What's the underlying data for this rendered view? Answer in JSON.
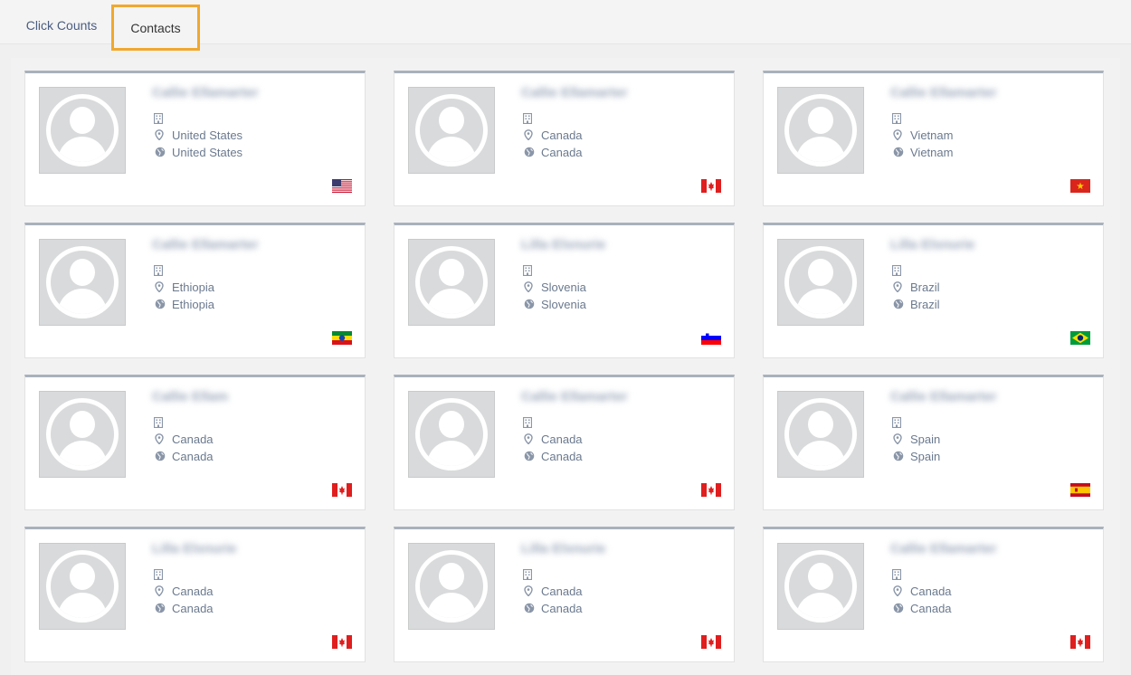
{
  "tabs": [
    {
      "label": "Click Counts"
    },
    {
      "label": "Contacts"
    }
  ],
  "contacts": [
    {
      "name": "Callie Ellamarter",
      "location": "United States",
      "country": "United States",
      "flag": "us-flag"
    },
    {
      "name": "Callie Ellamarter",
      "location": "Canada",
      "country": "Canada",
      "flag": "canada-flag"
    },
    {
      "name": "Callie Ellamarter",
      "location": "Vietnam",
      "country": "Vietnam",
      "flag": "vietnam-flag"
    },
    {
      "name": "Callie Ellamarter",
      "location": "Ethiopia",
      "country": "Ethiopia",
      "flag": "ethiopia-flag"
    },
    {
      "name": "Lilla Elsnurie",
      "location": "Slovenia",
      "country": "Slovenia",
      "flag": "slovenia-flag"
    },
    {
      "name": "Lilla Elsnurie",
      "location": "Brazil",
      "country": "Brazil",
      "flag": "brazil-flag"
    },
    {
      "name": "Callie Ellam",
      "location": "Canada",
      "country": "Canada",
      "flag": "canada-flag"
    },
    {
      "name": "Callie Ellamarter",
      "location": "Canada",
      "country": "Canada",
      "flag": "canada-flag"
    },
    {
      "name": "Callie Ellamarter",
      "location": "Spain",
      "country": "Spain",
      "flag": "spain-flag"
    },
    {
      "name": "Lilla Elsnurie",
      "location": "Canada",
      "country": "Canada",
      "flag": "canada-flag"
    },
    {
      "name": "Lilla Elsnurie",
      "location": "Canada",
      "country": "Canada",
      "flag": "canada-flag"
    },
    {
      "name": "Callie Ellamarter",
      "location": "Canada",
      "country": "Canada",
      "flag": "canada-flag"
    }
  ],
  "icons": {
    "building": "building-icon",
    "location": "map-marker-icon",
    "country": "globe-icon"
  },
  "colors": {
    "active_tab_border": "#f0a82e",
    "card_top_border": "#a9b1bb",
    "text": "#6b7a8f",
    "tab_text": "#4a5d80"
  }
}
